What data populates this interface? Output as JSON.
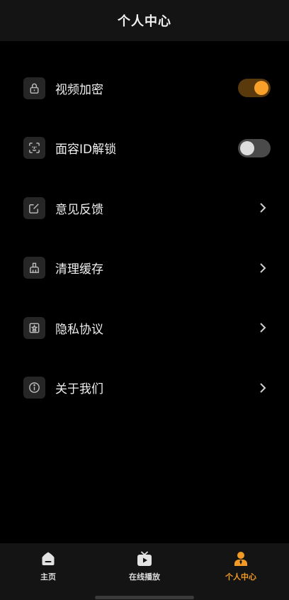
{
  "header": {
    "title": "个人中心"
  },
  "menu": {
    "items": [
      {
        "label": "视频加密",
        "icon": "lock-icon",
        "control": "toggle",
        "on": true
      },
      {
        "label": "面容ID解锁",
        "icon": "face-id-icon",
        "control": "toggle",
        "on": false
      },
      {
        "label": "意见反馈",
        "icon": "edit-icon",
        "control": "chevron"
      },
      {
        "label": "清理缓存",
        "icon": "broom-icon",
        "control": "chevron"
      },
      {
        "label": "隐私协议",
        "icon": "privacy-icon",
        "control": "chevron"
      },
      {
        "label": "关于我们",
        "icon": "info-icon",
        "control": "chevron"
      }
    ]
  },
  "tabbar": {
    "tabs": [
      {
        "label": "主页",
        "icon": "home-icon",
        "active": false
      },
      {
        "label": "在线播放",
        "icon": "tv-play-icon",
        "active": false
      },
      {
        "label": "个人中心",
        "icon": "person-icon",
        "active": true
      }
    ]
  },
  "colors": {
    "accent": "#f29a23",
    "toggle_on_track": "#5a3a0c",
    "toggle_off_track": "#4a4a4a",
    "background": "#000000",
    "bar_background": "#141414"
  }
}
